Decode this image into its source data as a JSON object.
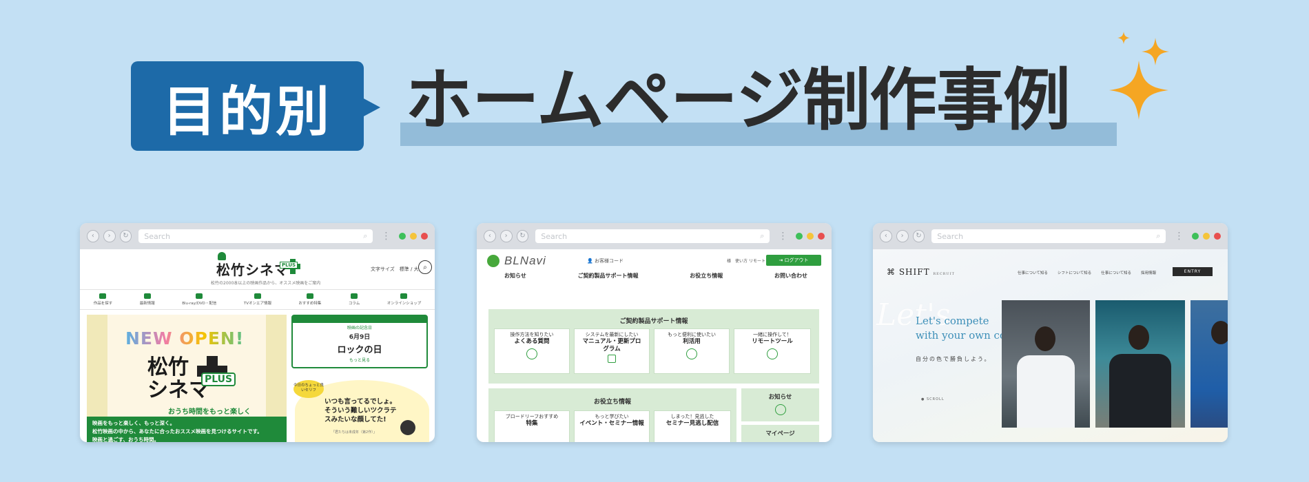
{
  "heading": {
    "tag": "目的別",
    "title": "ホームページ制作事例",
    "accent": "#1d6aa8",
    "sparkle_color": "#f5a623"
  },
  "browser_chrome": {
    "search_placeholder": "Search",
    "search_icon": "magnifier-icon",
    "back_icon": "chevron-left-icon",
    "forward_icon": "chevron-right-icon",
    "reload_icon": "reload-icon"
  },
  "site1": {
    "logo": "松竹シネマ",
    "logo_badge": "PLUS",
    "sub": "松竹の2000本以上の映画作品から、オススメ映画をご案内",
    "font_size_label": "文字サイズ",
    "font_size_std": "標準",
    "font_size_large": "大",
    "nav": [
      "作品を探す",
      "最新情報",
      "Blu-ray/DVD・配信",
      "TVオンエア情報",
      "おすすめ特集",
      "コラム",
      "オンラインショップ"
    ],
    "hero_new": "NEW OPEN!",
    "hero_name_1": "松竹",
    "hero_name_2": "シネマ",
    "hero_badge": "PLUS",
    "hero_tag": "おうち時間をもっと楽しく",
    "hero_desc_1": "映画をもっと楽しく、もっと深く。",
    "hero_desc_2": "松竹映画の中から、あなたに合ったおススメ映画を見つけるサイトです。",
    "hero_desc_3": "映画と過ごす、おうち時間。",
    "card_label": "映画の記念日",
    "card_date": "6月9日",
    "card_title": "ロックの日",
    "card_more": "もっと見る",
    "bubble": "今日のちょっと良いセリフ",
    "quote_1": "いつも言ってるでしょ。",
    "quote_2": "そういう難しいツクラテ",
    "quote_3": "スみたいな顔してた!",
    "quote_src": "「君たちは未成年（第2作）」"
  },
  "site2": {
    "logo": "BLNavi",
    "code": "お客様コード",
    "mini_1": "様",
    "mini_2": "使い方",
    "mini_3": "リモート",
    "logout": "ログアウト",
    "nav": [
      "お知らせ",
      "ご契約製品サポート情報",
      "お役立ち情報",
      "お問い合わせ"
    ],
    "sec1_title": "ご契約製品サポート情報",
    "sec1_boxes": [
      {
        "sub": "操作方法を知りたい",
        "main": "よくある質問"
      },
      {
        "sub": "システムを最新にしたい",
        "main": "マニュアル・更新プログラム"
      },
      {
        "sub": "もっと便利に使いたい",
        "main": "利活用"
      },
      {
        "sub": "一緒に操作して！",
        "main": "リモートツール"
      }
    ],
    "sec2_title": "お役立ち情報",
    "sec2_boxes": [
      {
        "sub": "ブロードリーフおすすめ",
        "main": "特集"
      },
      {
        "sub": "もっと学びたい",
        "main": "イベント・セミナー情報"
      },
      {
        "sub": "しまった！見逃した",
        "main": "セミナー見逃し配信"
      }
    ],
    "side_1": "お知らせ",
    "side_2": "マイページ",
    "brand_color": "#2f9e3f"
  },
  "site3": {
    "logo": "SHIFT",
    "logo_sub": "RECRUIT",
    "nav": [
      "仕事について知る",
      "シフトについて知る",
      "仕事について知る",
      "採用情報"
    ],
    "entry": "ENTRY",
    "ghost": "Let's",
    "en_1": "Let's compete",
    "en_2": "with your own color.",
    "jp": "自分の色で勝負しよう。",
    "scroll": "SCROLL"
  }
}
